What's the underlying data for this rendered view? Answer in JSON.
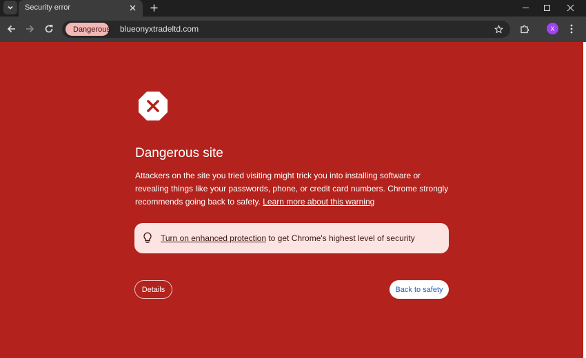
{
  "browser": {
    "tab_title": "Security error",
    "omnibox": {
      "chip_label": "Dangerous",
      "url": "blueonyxtradeltd.com"
    },
    "profile_initial": "X"
  },
  "page": {
    "background": "#b3221c",
    "title": "Dangerous site",
    "body": "Attackers on the site you tried visiting might trick you into installing software or revealing things like your passwords, phone, or credit card numbers. Chrome strongly recommends going back to safety.",
    "learn_more_link": "Learn more about this warning",
    "enhanced": {
      "link": "Turn on enhanced protection",
      "rest": "to get Chrome's highest level of security"
    },
    "details_button": "Details",
    "back_button": "Back to safety"
  },
  "colors": {
    "danger": "#b3221c",
    "chip": "#f2b8b5",
    "link_blue": "#1a5fc7",
    "profile": "#a142f4"
  },
  "icons": {
    "tab_search": "chevron-down-icon",
    "tab_close": "close-icon",
    "new_tab": "plus-icon",
    "back": "arrow-left-icon",
    "forward": "arrow-right-icon",
    "reload": "reload-icon",
    "chip": "danger-circle-icon",
    "bookmark": "star-icon",
    "extensions": "puzzle-icon",
    "menu": "kebab-menu-icon",
    "warning": "octagon-x-icon",
    "tip": "lightbulb-icon"
  }
}
